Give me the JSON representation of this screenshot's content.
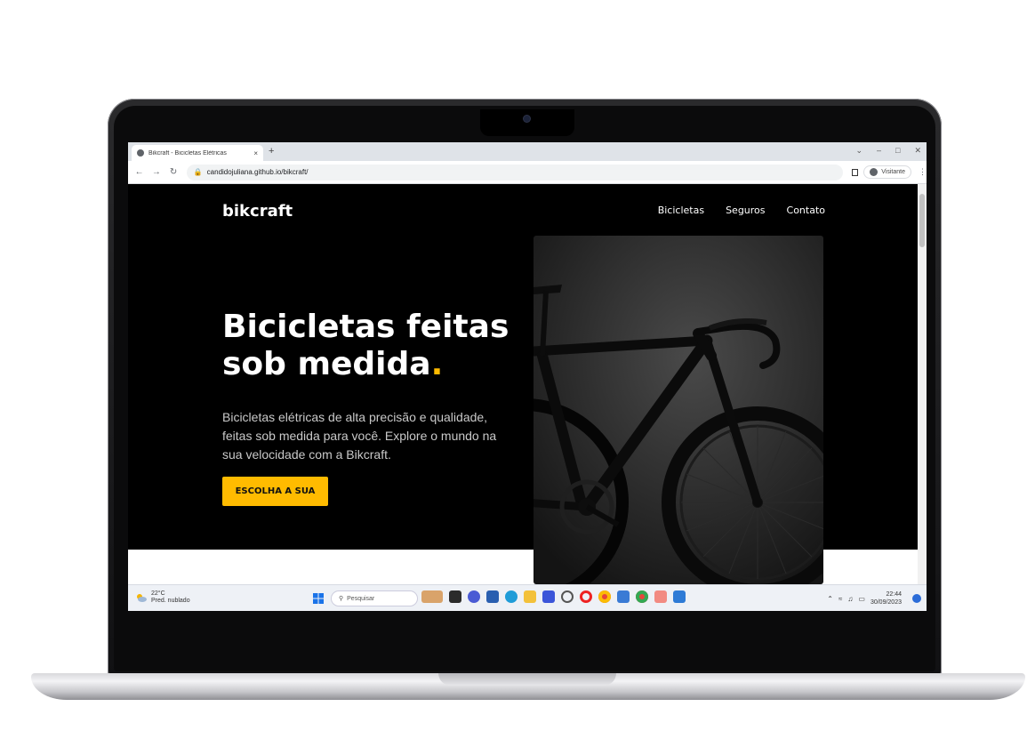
{
  "browser": {
    "tab_title": "Bikcraft - Bicicletas Elétricas",
    "tab_close": "×",
    "new_tab": "+",
    "url": "candidojuliana.github.io/bikcraft/",
    "profile_label": "Visitante"
  },
  "site": {
    "logo": "bikcraft",
    "nav": [
      "Bicicletas",
      "Seguros",
      "Contato"
    ],
    "hero_title_line1": "Bicicletas feitas",
    "hero_title_line2": "sob medida",
    "hero_title_dot": ".",
    "hero_text": "Bicicletas elétricas de alta precisão e qualidade, feitas sob medida para você. Explore o mundo na sua velocidade com a Bikcraft.",
    "cta_label": "ESCOLHA A SUA",
    "accent_color": "#ffbb00"
  },
  "taskbar": {
    "weather_temp": "22°C",
    "weather_desc": "Pred. nublado",
    "search_placeholder": "Pesquisar",
    "time": "22:44",
    "date": "30/09/2023"
  }
}
